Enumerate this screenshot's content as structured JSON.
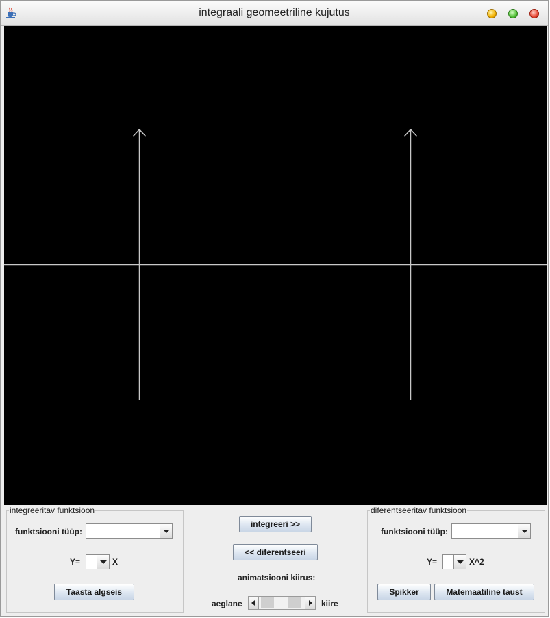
{
  "window": {
    "title": "integraali geomeetriline kujutus",
    "icon": "java-coffee-cup-icon"
  },
  "canvas": {
    "background": "#000000",
    "axis_color": "#c8c8c8"
  },
  "left_panel": {
    "title": "integreeritav funktsioon",
    "type_label": "funktsiooni tüüp:",
    "type_value": "",
    "y_label": "Y=",
    "coef_value": "",
    "x_term": "X",
    "reset_button": "Taasta algseis"
  },
  "center": {
    "integrate_button": "integreeri >>",
    "differentiate_button": "<< diferentseeri",
    "speed_label": "animatsiooni kiirus:",
    "slow_label": "aeglane",
    "fast_label": "kiire"
  },
  "right_panel": {
    "title": "diferentseeritav funktsioon",
    "type_label": "funktsiooni tüüp:",
    "type_value": "",
    "y_label": "Y=",
    "coef_value": "",
    "x_term": "X^2",
    "help_button": "Spikker",
    "background_button": "Matemaatiline taust"
  }
}
